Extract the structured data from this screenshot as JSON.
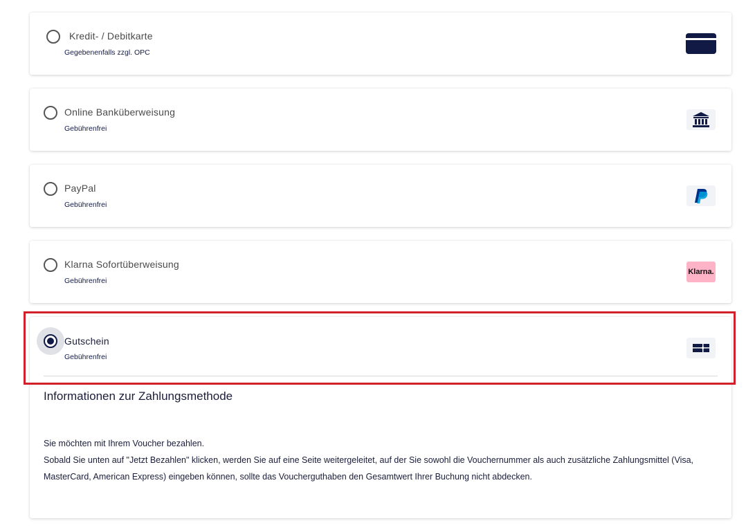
{
  "payment_methods": [
    {
      "title": "Kredit- / Debitkarte",
      "subtitle": "Gegebenenfalls zzgl. OPC",
      "icon": "credit-card-icon",
      "selected": false
    },
    {
      "title": "Online Banküberweisung",
      "subtitle": "Gebührenfrei",
      "icon": "bank-icon",
      "selected": false
    },
    {
      "title": "PayPal",
      "subtitle": "Gebührenfrei",
      "icon": "paypal-icon",
      "selected": false
    },
    {
      "title": "Klarna Sofortüberweisung",
      "subtitle": "Gebührenfrei",
      "icon": "klarna-icon",
      "logo_text": "Klarna.",
      "selected": false
    },
    {
      "title": "Gutschein",
      "subtitle": "Gebührenfrei",
      "icon": "gift-card-icon",
      "selected": true
    }
  ],
  "info": {
    "title": "Informationen zur Zahlungsmethode",
    "line1": "Sie möchten mit Ihrem Voucher bezahlen.",
    "line2": "Sobald Sie unten auf \"Jetzt Bezahlen\" klicken, werden Sie auf eine Seite weitergeleitet, auf der Sie sowohl die Vouchernummer als auch zusätzliche Zahlungsmittel (Visa, MasterCard, American Express) eingeben können, sollte das Voucherguthaben den Gesamtwert Ihrer Buchung nicht abdecken."
  },
  "colors": {
    "navy": "#111a45",
    "highlight": "#d2202a",
    "klarna_pink": "#ffb3c7",
    "paypal_dark": "#003087",
    "paypal_light": "#009cde"
  }
}
